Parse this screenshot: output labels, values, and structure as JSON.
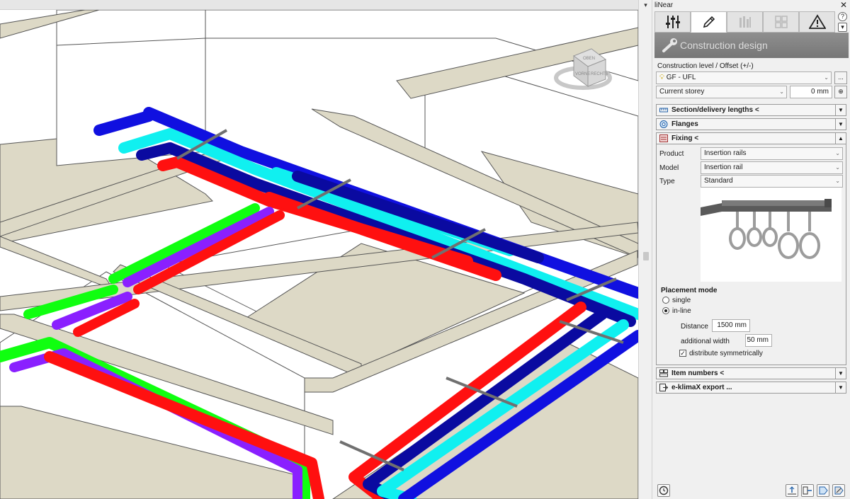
{
  "panel": {
    "title": "liNear",
    "close_glyph": "✕",
    "tabs": [
      {
        "icon": "sliders-icon"
      },
      {
        "icon": "pencil-icon"
      },
      {
        "icon": "bar-chart-icon"
      },
      {
        "icon": "grid-icon"
      },
      {
        "icon": "warning-icon"
      }
    ],
    "header": "Construction design",
    "construction_level_label": "Construction level / Offset (+/-)",
    "level_value": "GF - UFL",
    "level_more": "...",
    "storey_value": "Current storey",
    "offset_value": "0 mm"
  },
  "sections": {
    "section_lengths": "Section/delivery lengths <",
    "flanges": "Flanges",
    "fixing": "Fixing <",
    "item_numbers": "Item numbers <",
    "export": "e-klimaX export ..."
  },
  "fixing": {
    "product_label": "Product",
    "product_value": "Insertion rails",
    "model_label": "Model",
    "model_value": "Insertion rail",
    "type_label": "Type",
    "type_value": "Standard",
    "placement_mode_label": "Placement mode",
    "single_label": "single",
    "inline_label": "in-line",
    "distance_label": "Distance",
    "distance_value": "1500 mm",
    "additional_width_label": "additional width",
    "additional_width_value": "50 mm",
    "distribute_label": "distribute symmetrically",
    "placement_mode": "in-line",
    "distribute_checked": true
  },
  "viewcube": {
    "top_label": "OBEN",
    "front_label": "VORNE",
    "right_label": "RECHTS"
  },
  "colors": {
    "pipe_blue": "#1010e0",
    "pipe_navy": "#0a0aa0",
    "pipe_cyan": "#10f0f0",
    "pipe_red": "#ff1010",
    "pipe_green": "#10ff10",
    "pipe_purple": "#8a20ff",
    "floor": "#ddd9c6"
  }
}
